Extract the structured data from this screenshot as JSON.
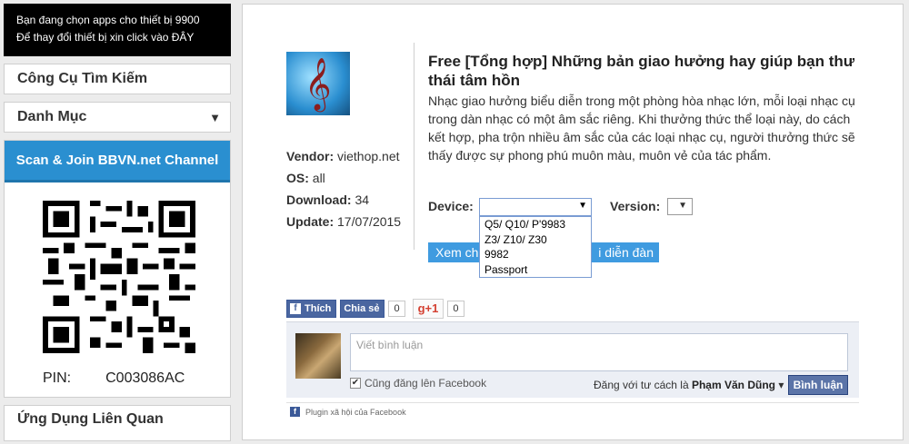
{
  "sidebar": {
    "device_notice_line1": "Bạn đang chọn apps cho thiết bị 9900",
    "device_notice_line2": "Để thay đổi thiết bị xin click vào ĐÂY",
    "search_tools": "Công Cụ Tìm Kiếm",
    "categories": "Danh Mục",
    "categories_arrow": "▼",
    "qr_heading": "Scan & Join BBVN.net Channel",
    "pin_label": "PIN:",
    "pin_value": "C003086AC",
    "related_apps": "Ứng Dụng Liên Quan"
  },
  "app": {
    "icon": "music-clef-icon",
    "icon_glyph": "𝄞",
    "title": "Free [Tổng hợp] Những bản giao hưởng hay giúp bạn thư thái tâm hồn",
    "description": "Nhạc giao hưởng biểu diễn trong một phòng hòa nhạc lớn, mỗi loại nhạc cụ trong dàn nhạc có một âm sắc riêng. Khi thưởng thức thể loại này, do cách kết hợp, pha trộn nhiều âm sắc của các loại nhạc cụ, người thưởng thức sẽ thấy được sự phong phú muôn màu, muôn vẻ của tác phẩm.",
    "vendor_label": "Vendor:",
    "vendor": "viethop.net",
    "os_label": "OS:",
    "os": "all",
    "download_label": "Download:",
    "download": "34",
    "update_label": "Update:",
    "update": "17/07/2015"
  },
  "form": {
    "device_label": "Device:",
    "device_value": "",
    "version_label": "Version:",
    "version_value": "",
    "caret": "▼",
    "device_options": [
      "Q5/ Q10/ P'9983",
      "Z3/ Z10/ Z30",
      "9982",
      "Passport"
    ],
    "action_left": "Xem ch",
    "action_right": "i diễn đàn"
  },
  "social": {
    "like_label": "Thích",
    "like_count": "0",
    "share_label": "Chia sẻ",
    "gplus_label": "g+1",
    "gplus_count": "0",
    "fb_glyph": "f"
  },
  "comments": {
    "placeholder": "Viết bình luận",
    "also_post": "Cũng đăng lên Facebook",
    "post_as_prefix": "Đăng với tư cách là",
    "user": "Phạm Văn Dũng",
    "post_button": "Bình luận",
    "plugin_text": "Plugin xã hội của Facebook",
    "check": "✔"
  },
  "colors": {
    "qr_header": "#2a8fd0",
    "facebook_blue": "#3b5998",
    "action_blue": "#3f9be0"
  }
}
